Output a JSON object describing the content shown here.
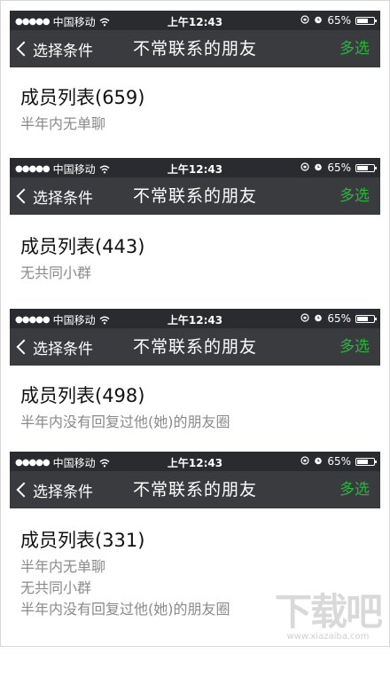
{
  "status": {
    "carrier": "中国移动",
    "signal_dots": "●●●●●",
    "time": "上午12:43",
    "battery": "65%",
    "battery_level": 0.65
  },
  "nav": {
    "back_label": "选择条件",
    "title": "不常联系的朋友",
    "action_label": "多选",
    "action_color": "#27b83a"
  },
  "panels": [
    {
      "heading": "成员列表(659)",
      "lines": [
        "半年内无单聊"
      ]
    },
    {
      "heading": "成员列表(443)",
      "lines": [
        "无共同小群"
      ]
    },
    {
      "heading": "成员列表(498)",
      "lines": [
        "半年内没有回复过他(她)的朋友圈"
      ]
    },
    {
      "heading": "成员列表(331)",
      "lines": [
        "半年内无单聊",
        "无共同小群",
        "半年内没有回复过他(她)的朋友圈"
      ]
    }
  ],
  "watermark": {
    "big": "下载吧",
    "small": "www.xiazaiba.com"
  }
}
